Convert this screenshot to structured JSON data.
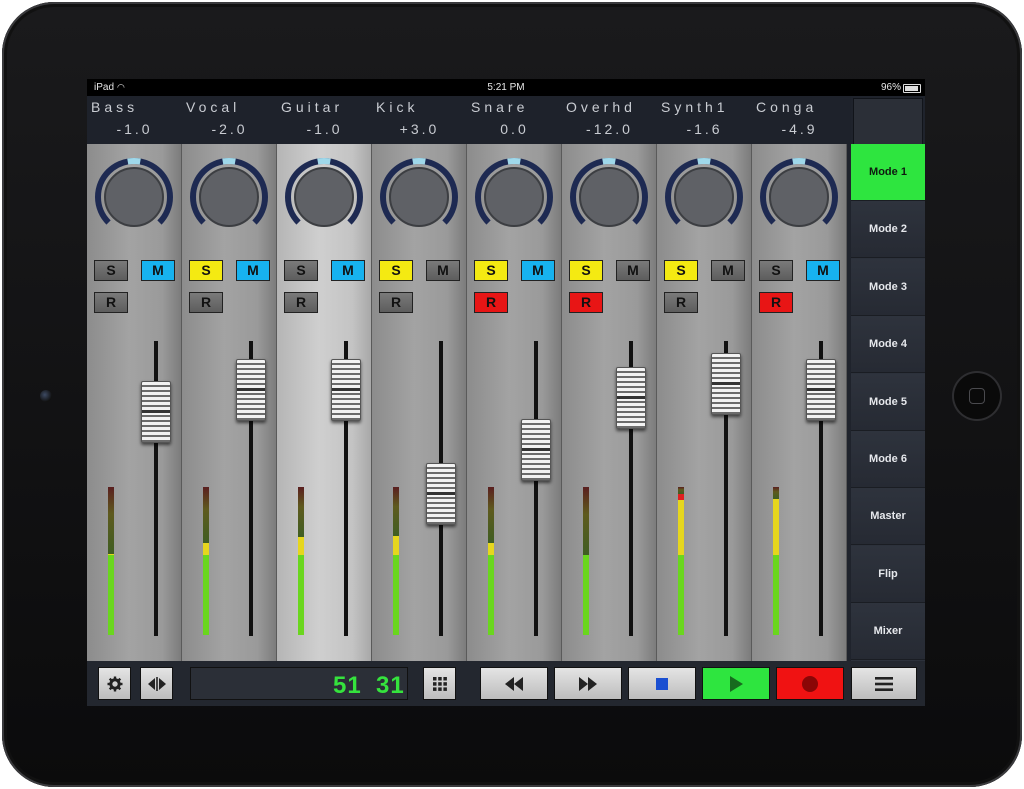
{
  "status_bar": {
    "device": "iPad",
    "time": "5:21 PM",
    "battery": "96%"
  },
  "channels": [
    {
      "name": "Bass",
      "value": "-1.0",
      "selected": false,
      "solo_on": false,
      "mute_on": true,
      "rec_on": false,
      "fader_level": 0.78,
      "meter_level": 0.55,
      "meter_peak": false,
      "knob_color": "#1e2a52"
    },
    {
      "name": "Vocal",
      "value": "-2.0",
      "selected": false,
      "solo_on": true,
      "mute_on": true,
      "rec_on": false,
      "fader_level": 0.86,
      "meter_level": 0.62,
      "meter_peak": false,
      "knob_color": "#1e2a52"
    },
    {
      "name": "Guitar",
      "value": "-1.0",
      "selected": true,
      "solo_on": false,
      "mute_on": true,
      "rec_on": false,
      "fader_level": 0.86,
      "meter_level": 0.66,
      "meter_peak": false,
      "knob_color": "#1e2a52"
    },
    {
      "name": "Kick",
      "value": "+3.0",
      "selected": false,
      "solo_on": true,
      "mute_on": false,
      "rec_on": false,
      "fader_level": 0.48,
      "meter_level": 0.67,
      "meter_peak": false,
      "knob_color": "#1e2a52"
    },
    {
      "name": "Snare",
      "value": "0.0",
      "selected": false,
      "solo_on": true,
      "mute_on": true,
      "rec_on": true,
      "fader_level": 0.64,
      "meter_level": 0.62,
      "meter_peak": false,
      "knob_color": "#1e2a52"
    },
    {
      "name": "Overhd",
      "value": "-12.0",
      "selected": false,
      "solo_on": true,
      "mute_on": false,
      "rec_on": true,
      "fader_level": 0.83,
      "meter_level": 0.54,
      "meter_peak": false,
      "knob_color": "#1e2a52"
    },
    {
      "name": "Synth1",
      "value": "-1.6",
      "selected": false,
      "solo_on": true,
      "mute_on": false,
      "rec_on": false,
      "fader_level": 0.88,
      "meter_level": 0.95,
      "meter_peak": true,
      "knob_color": "#1e2a52"
    },
    {
      "name": "Conga",
      "value": "-4.9",
      "selected": false,
      "solo_on": false,
      "mute_on": true,
      "rec_on": true,
      "fader_level": 0.86,
      "meter_level": 0.92,
      "meter_peak": false,
      "knob_color": "#1e2a52"
    }
  ],
  "buttons": {
    "solo": "S",
    "mute": "M",
    "rec": "R"
  },
  "modes": [
    "Mode 1",
    "Mode 2",
    "Mode 3",
    "Mode 4",
    "Mode 5",
    "Mode 6",
    "Master",
    "Flip",
    "Mixer"
  ],
  "active_mode": "Mode 1",
  "transport": {
    "counter_bar": "51",
    "counter_beat": "31",
    "icons": [
      "gear-icon",
      "swap-arrows-icon",
      "grid-icon",
      "rewind-icon",
      "fast-forward-icon",
      "stop-icon",
      "play-icon",
      "record-icon",
      "menu-icon"
    ]
  },
  "colors": {
    "accent": "#2ee53f",
    "solo": "#f4ea12",
    "mute": "#17b2ef",
    "record": "#e81515",
    "counter": "#35e33d"
  }
}
